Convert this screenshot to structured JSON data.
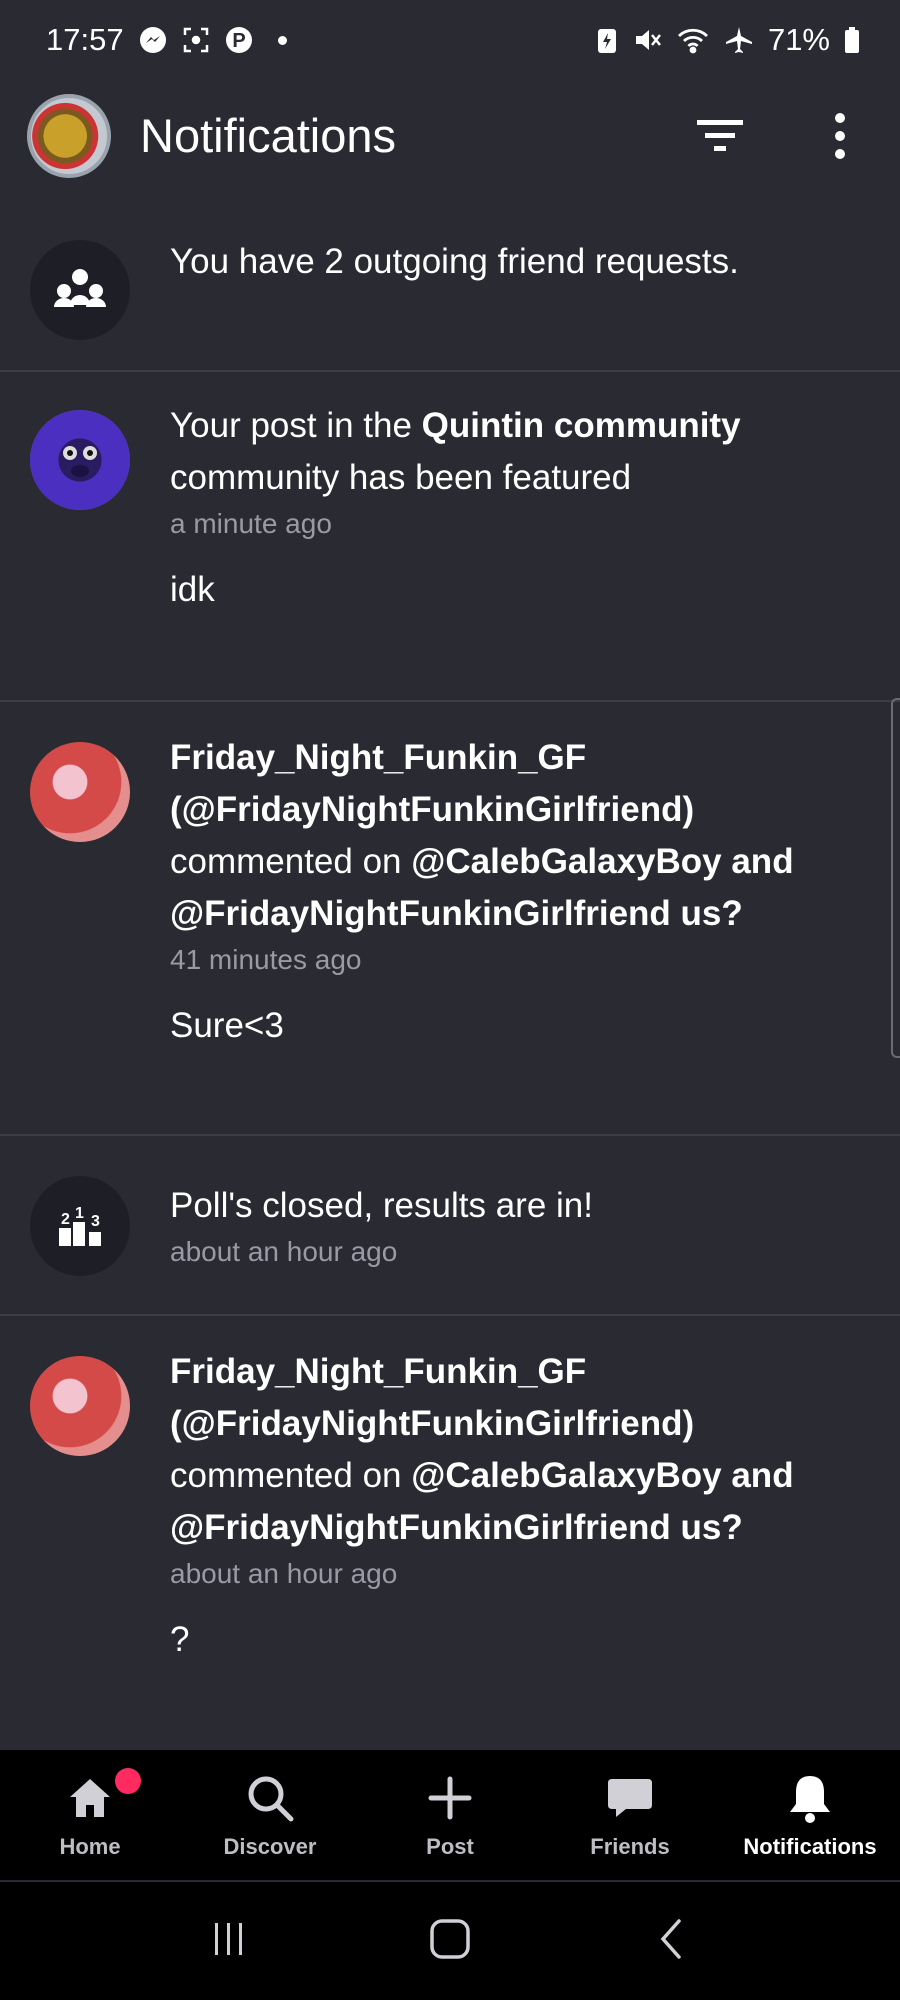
{
  "status_bar": {
    "time": "17:57",
    "battery": "71%"
  },
  "header": {
    "title": "Notifications"
  },
  "notifications": [
    {
      "text_parts": [
        "You have 2 outgoing friend requests."
      ],
      "time": "",
      "comment": ""
    },
    {
      "prefix": "Your post in the ",
      "bold1": "Quintin community",
      "suffix": " community has been featured",
      "time": "a minute ago",
      "comment": "idk"
    },
    {
      "actor": "Friday_Night_Funkin_GF (@FridayNightFunkinGirlfriend)",
      "middle": " commented on ",
      "target": "@CalebGalaxyBoy and @FridayNightFunkinGirlfriend us?",
      "time": "41 minutes ago",
      "comment": "Sure<3"
    },
    {
      "text": "Poll's closed, results are in!",
      "time": "about an hour ago"
    },
    {
      "actor": "Friday_Night_Funkin_GF (@FridayNightFunkinGirlfriend)",
      "middle": " commented on ",
      "target": "@CalebGalaxyBoy and @FridayNightFunkinGirlfriend us?",
      "time": "about an hour ago",
      "comment": "?"
    }
  ],
  "bottom_nav": {
    "home": "Home",
    "discover": "Discover",
    "post": "Post",
    "friends": "Friends",
    "notifications": "Notifications"
  },
  "colors": {
    "background": "#2a2a33",
    "badge": "#ff2a5f",
    "nav_bg": "#000000"
  }
}
